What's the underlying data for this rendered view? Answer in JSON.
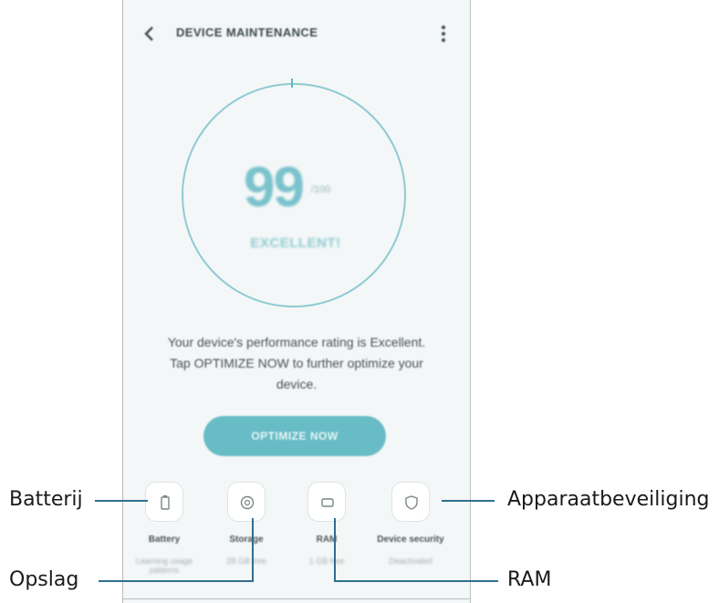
{
  "app": {
    "title": "DEVICE MAINTENANCE",
    "back_icon": "chevron-left-icon",
    "menu_icon": "more-vertical-icon"
  },
  "score": {
    "value": "99",
    "max": "/100",
    "status": "EXCELLENT!"
  },
  "message": {
    "line1": "Your device's performance rating is Excellent.",
    "line2": "Tap OPTIMIZE NOW to further optimize your",
    "line3": "device."
  },
  "optimize_button": "OPTIMIZE NOW",
  "tiles": [
    {
      "label": "Battery",
      "sub": "Learning usage patterns",
      "icon": "battery-icon"
    },
    {
      "label": "Storage",
      "sub": "28 GB free",
      "icon": "storage-icon"
    },
    {
      "label": "RAM",
      "sub": "1 GB free",
      "icon": "ram-icon"
    },
    {
      "label": "Device security",
      "sub": "Deactivated",
      "icon": "shield-icon"
    }
  ],
  "callouts": {
    "battery": "Batterij",
    "storage": "Opslag",
    "ram": "RAM",
    "security": "Apparaatbeveiliging"
  },
  "colors": {
    "accent": "#68bcc6",
    "ring": "#8ecbd2",
    "leader": "#2f6f8f",
    "background": "#f4f7f7"
  }
}
